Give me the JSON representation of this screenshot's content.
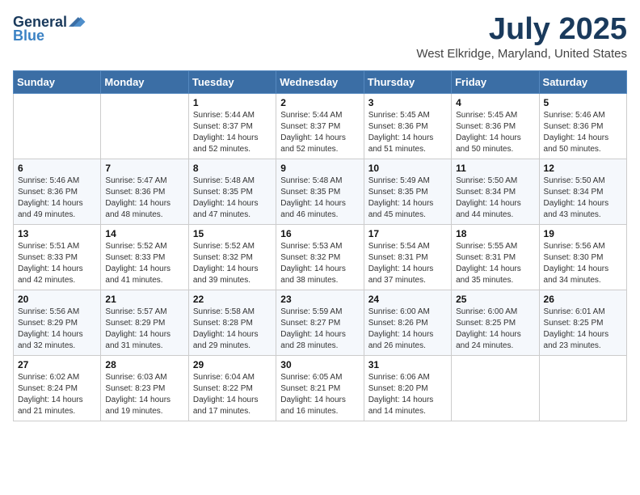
{
  "header": {
    "logo_general": "General",
    "logo_blue": "Blue",
    "month": "July 2025",
    "location": "West Elkridge, Maryland, United States"
  },
  "days_of_week": [
    "Sunday",
    "Monday",
    "Tuesday",
    "Wednesday",
    "Thursday",
    "Friday",
    "Saturday"
  ],
  "weeks": [
    [
      {
        "day": "",
        "sunrise": "",
        "sunset": "",
        "daylight": ""
      },
      {
        "day": "",
        "sunrise": "",
        "sunset": "",
        "daylight": ""
      },
      {
        "day": "1",
        "sunrise": "Sunrise: 5:44 AM",
        "sunset": "Sunset: 8:37 PM",
        "daylight": "Daylight: 14 hours and 52 minutes."
      },
      {
        "day": "2",
        "sunrise": "Sunrise: 5:44 AM",
        "sunset": "Sunset: 8:37 PM",
        "daylight": "Daylight: 14 hours and 52 minutes."
      },
      {
        "day": "3",
        "sunrise": "Sunrise: 5:45 AM",
        "sunset": "Sunset: 8:36 PM",
        "daylight": "Daylight: 14 hours and 51 minutes."
      },
      {
        "day": "4",
        "sunrise": "Sunrise: 5:45 AM",
        "sunset": "Sunset: 8:36 PM",
        "daylight": "Daylight: 14 hours and 50 minutes."
      },
      {
        "day": "5",
        "sunrise": "Sunrise: 5:46 AM",
        "sunset": "Sunset: 8:36 PM",
        "daylight": "Daylight: 14 hours and 50 minutes."
      }
    ],
    [
      {
        "day": "6",
        "sunrise": "Sunrise: 5:46 AM",
        "sunset": "Sunset: 8:36 PM",
        "daylight": "Daylight: 14 hours and 49 minutes."
      },
      {
        "day": "7",
        "sunrise": "Sunrise: 5:47 AM",
        "sunset": "Sunset: 8:36 PM",
        "daylight": "Daylight: 14 hours and 48 minutes."
      },
      {
        "day": "8",
        "sunrise": "Sunrise: 5:48 AM",
        "sunset": "Sunset: 8:35 PM",
        "daylight": "Daylight: 14 hours and 47 minutes."
      },
      {
        "day": "9",
        "sunrise": "Sunrise: 5:48 AM",
        "sunset": "Sunset: 8:35 PM",
        "daylight": "Daylight: 14 hours and 46 minutes."
      },
      {
        "day": "10",
        "sunrise": "Sunrise: 5:49 AM",
        "sunset": "Sunset: 8:35 PM",
        "daylight": "Daylight: 14 hours and 45 minutes."
      },
      {
        "day": "11",
        "sunrise": "Sunrise: 5:50 AM",
        "sunset": "Sunset: 8:34 PM",
        "daylight": "Daylight: 14 hours and 44 minutes."
      },
      {
        "day": "12",
        "sunrise": "Sunrise: 5:50 AM",
        "sunset": "Sunset: 8:34 PM",
        "daylight": "Daylight: 14 hours and 43 minutes."
      }
    ],
    [
      {
        "day": "13",
        "sunrise": "Sunrise: 5:51 AM",
        "sunset": "Sunset: 8:33 PM",
        "daylight": "Daylight: 14 hours and 42 minutes."
      },
      {
        "day": "14",
        "sunrise": "Sunrise: 5:52 AM",
        "sunset": "Sunset: 8:33 PM",
        "daylight": "Daylight: 14 hours and 41 minutes."
      },
      {
        "day": "15",
        "sunrise": "Sunrise: 5:52 AM",
        "sunset": "Sunset: 8:32 PM",
        "daylight": "Daylight: 14 hours and 39 minutes."
      },
      {
        "day": "16",
        "sunrise": "Sunrise: 5:53 AM",
        "sunset": "Sunset: 8:32 PM",
        "daylight": "Daylight: 14 hours and 38 minutes."
      },
      {
        "day": "17",
        "sunrise": "Sunrise: 5:54 AM",
        "sunset": "Sunset: 8:31 PM",
        "daylight": "Daylight: 14 hours and 37 minutes."
      },
      {
        "day": "18",
        "sunrise": "Sunrise: 5:55 AM",
        "sunset": "Sunset: 8:31 PM",
        "daylight": "Daylight: 14 hours and 35 minutes."
      },
      {
        "day": "19",
        "sunrise": "Sunrise: 5:56 AM",
        "sunset": "Sunset: 8:30 PM",
        "daylight": "Daylight: 14 hours and 34 minutes."
      }
    ],
    [
      {
        "day": "20",
        "sunrise": "Sunrise: 5:56 AM",
        "sunset": "Sunset: 8:29 PM",
        "daylight": "Daylight: 14 hours and 32 minutes."
      },
      {
        "day": "21",
        "sunrise": "Sunrise: 5:57 AM",
        "sunset": "Sunset: 8:29 PM",
        "daylight": "Daylight: 14 hours and 31 minutes."
      },
      {
        "day": "22",
        "sunrise": "Sunrise: 5:58 AM",
        "sunset": "Sunset: 8:28 PM",
        "daylight": "Daylight: 14 hours and 29 minutes."
      },
      {
        "day": "23",
        "sunrise": "Sunrise: 5:59 AM",
        "sunset": "Sunset: 8:27 PM",
        "daylight": "Daylight: 14 hours and 28 minutes."
      },
      {
        "day": "24",
        "sunrise": "Sunrise: 6:00 AM",
        "sunset": "Sunset: 8:26 PM",
        "daylight": "Daylight: 14 hours and 26 minutes."
      },
      {
        "day": "25",
        "sunrise": "Sunrise: 6:00 AM",
        "sunset": "Sunset: 8:25 PM",
        "daylight": "Daylight: 14 hours and 24 minutes."
      },
      {
        "day": "26",
        "sunrise": "Sunrise: 6:01 AM",
        "sunset": "Sunset: 8:25 PM",
        "daylight": "Daylight: 14 hours and 23 minutes."
      }
    ],
    [
      {
        "day": "27",
        "sunrise": "Sunrise: 6:02 AM",
        "sunset": "Sunset: 8:24 PM",
        "daylight": "Daylight: 14 hours and 21 minutes."
      },
      {
        "day": "28",
        "sunrise": "Sunrise: 6:03 AM",
        "sunset": "Sunset: 8:23 PM",
        "daylight": "Daylight: 14 hours and 19 minutes."
      },
      {
        "day": "29",
        "sunrise": "Sunrise: 6:04 AM",
        "sunset": "Sunset: 8:22 PM",
        "daylight": "Daylight: 14 hours and 17 minutes."
      },
      {
        "day": "30",
        "sunrise": "Sunrise: 6:05 AM",
        "sunset": "Sunset: 8:21 PM",
        "daylight": "Daylight: 14 hours and 16 minutes."
      },
      {
        "day": "31",
        "sunrise": "Sunrise: 6:06 AM",
        "sunset": "Sunset: 8:20 PM",
        "daylight": "Daylight: 14 hours and 14 minutes."
      },
      {
        "day": "",
        "sunrise": "",
        "sunset": "",
        "daylight": ""
      },
      {
        "day": "",
        "sunrise": "",
        "sunset": "",
        "daylight": ""
      }
    ]
  ]
}
